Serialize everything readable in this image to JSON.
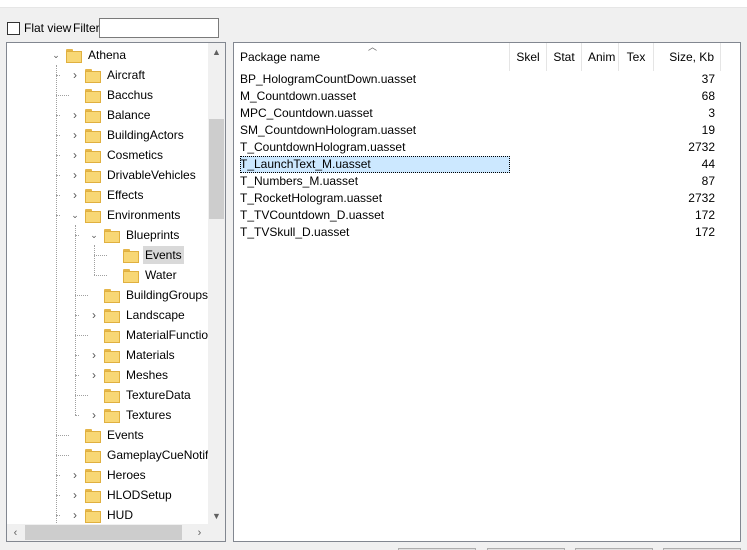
{
  "toolbar": {
    "flat_view_label": "Flat view",
    "flat_view_checked": false,
    "filter_label": "Filter:",
    "filter_value": ""
  },
  "tree": {
    "items": [
      {
        "label": "Athena",
        "expander": "down"
      },
      {
        "label": "Aircraft",
        "expander": "right"
      },
      {
        "label": "Bacchus",
        "expander": ""
      },
      {
        "label": "Balance",
        "expander": "right"
      },
      {
        "label": "BuildingActors",
        "expander": "right"
      },
      {
        "label": "Cosmetics",
        "expander": "right"
      },
      {
        "label": "DrivableVehicles",
        "expander": "right"
      },
      {
        "label": "Effects",
        "expander": "right"
      },
      {
        "label": "Environments",
        "expander": "down"
      },
      {
        "label": "Blueprints",
        "expander": "down"
      },
      {
        "label": "Events",
        "expander": "",
        "selected": true
      },
      {
        "label": "Water",
        "expander": ""
      },
      {
        "label": "BuildingGroups",
        "expander": ""
      },
      {
        "label": "Landscape",
        "expander": "right"
      },
      {
        "label": "MaterialFunctions",
        "expander": ""
      },
      {
        "label": "Materials",
        "expander": "right"
      },
      {
        "label": "Meshes",
        "expander": "right"
      },
      {
        "label": "TextureData",
        "expander": ""
      },
      {
        "label": "Textures",
        "expander": "right"
      },
      {
        "label": "Events",
        "expander": ""
      },
      {
        "label": "GameplayCueNotifies",
        "expander": ""
      },
      {
        "label": "Heroes",
        "expander": "right"
      },
      {
        "label": "HLODSetup",
        "expander": "right"
      },
      {
        "label": "HUD",
        "expander": "right"
      }
    ]
  },
  "list": {
    "columns": [
      {
        "label": "Package name"
      },
      {
        "label": "Skel"
      },
      {
        "label": "Stat"
      },
      {
        "label": "Anim"
      },
      {
        "label": "Tex"
      },
      {
        "label": "Size, Kb"
      }
    ],
    "rows": [
      {
        "name": "BP_HologramCountDown.uasset",
        "size": "37"
      },
      {
        "name": "M_Countdown.uasset",
        "size": "68"
      },
      {
        "name": "MPC_Countdown.uasset",
        "size": "3"
      },
      {
        "name": "SM_CountdownHologram.uasset",
        "size": "19"
      },
      {
        "name": "T_CountdownHologram.uasset",
        "size": "2732"
      },
      {
        "name": "T_LaunchText_M.uasset",
        "size": "44",
        "selected": true
      },
      {
        "name": "T_Numbers_M.uasset",
        "size": "87"
      },
      {
        "name": "T_RocketHologram.uasset",
        "size": "2732"
      },
      {
        "name": "T_TVCountdown_D.uasset",
        "size": "172"
      },
      {
        "name": "T_TVSkull_D.uasset",
        "size": "172"
      }
    ]
  },
  "colors": {
    "selection": "#cce8ff",
    "tree_selection": "#d9d9d9",
    "folder": "#f8d775"
  }
}
